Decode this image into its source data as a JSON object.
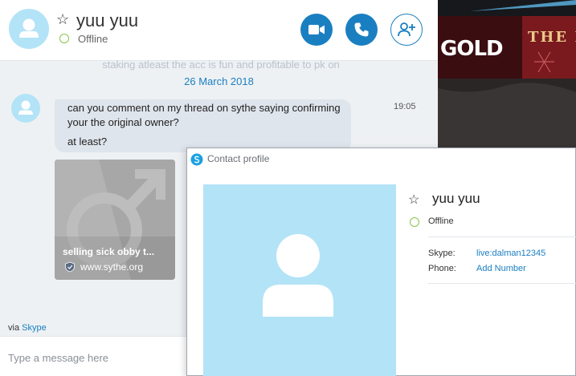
{
  "header": {
    "contact_name": "yuu yuu",
    "status": "Offline",
    "favorite_icon": "star-outline-icon",
    "buttons": {
      "video_call": "video-camera-icon",
      "audio_call": "phone-icon",
      "add_people": "add-person-icon"
    }
  },
  "conversation": {
    "faded_message": "staking atleast the acc is fun and profitable to pk on",
    "date": "26 March 2018",
    "message": {
      "line1": "can you comment on my thread on sythe saying confirming your the original owner?",
      "line2": "at least?",
      "time": "19:05"
    },
    "link_preview": {
      "title": "selling sick obby t...",
      "domain": "www.sythe.org"
    }
  },
  "footer": {
    "via_prefix": "via",
    "via_link": "Skype",
    "composer_placeholder": "Type a message here"
  },
  "background_banner": {
    "text_left": "GOLD",
    "text_right": "THE P"
  },
  "profile_panel": {
    "title": "Contact profile",
    "name": "yuu yuu",
    "status": "Offline",
    "skype_label": "Skype:",
    "skype_value": "live:dalman12345",
    "phone_label": "Phone:",
    "phone_value": "Add Number"
  },
  "colors": {
    "accent": "#1a7fc1",
    "avatar_bg": "#b3e3f7",
    "presence_offline": "#8bc34a",
    "bubble_bg": "#dfe5ec"
  }
}
